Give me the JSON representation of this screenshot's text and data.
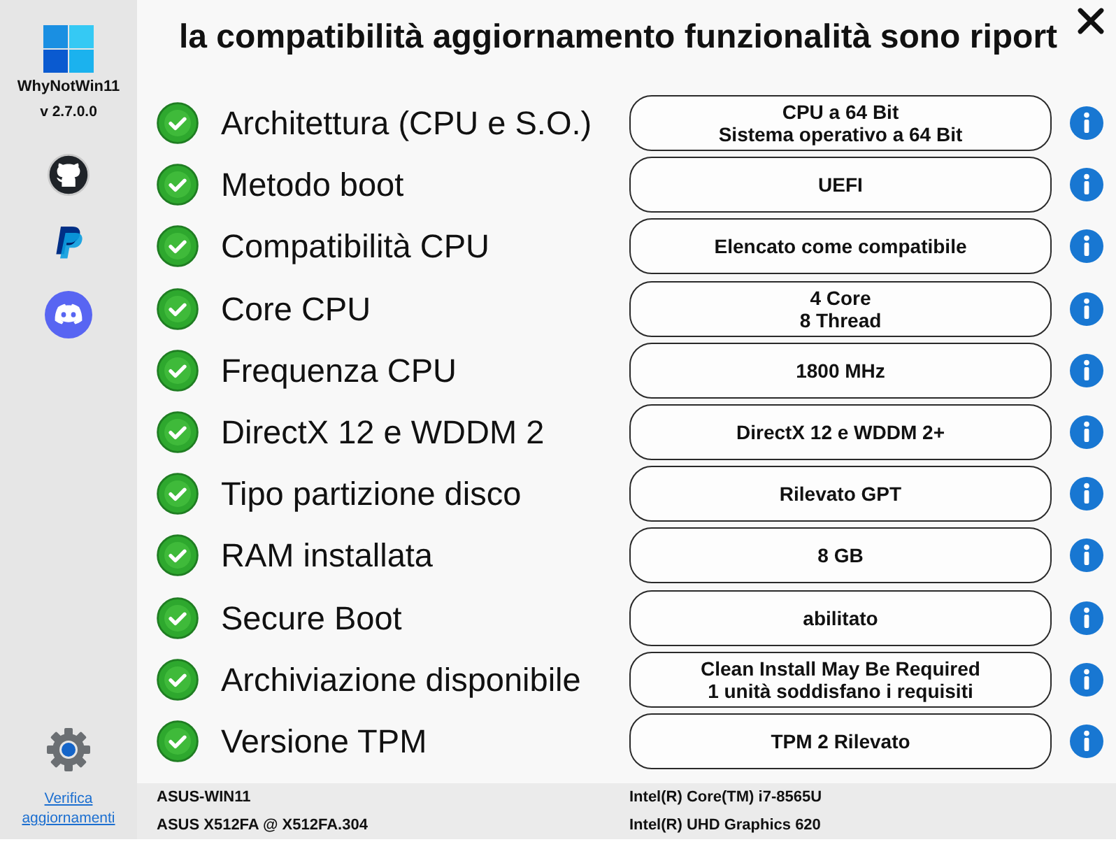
{
  "sidebar": {
    "app_name": "WhyNotWin11",
    "version": "v 2.7.0.0",
    "update_link": "Verifica aggiornamenti"
  },
  "title": "la compatibilità aggiornamento funzionalità sono riport",
  "checks": [
    {
      "passed": true,
      "label": "Architettura (CPU e S.O.)",
      "result": "CPU a 64 Bit\nSistema operativo a 64 Bit"
    },
    {
      "passed": true,
      "label": "Metodo boot",
      "result": "UEFI"
    },
    {
      "passed": true,
      "label": "Compatibilità CPU",
      "result": "Elencato come compatibile"
    },
    {
      "passed": true,
      "label": "Core CPU",
      "result": "4 Core\n8 Thread"
    },
    {
      "passed": true,
      "label": "Frequenza CPU",
      "result": "1800 MHz"
    },
    {
      "passed": true,
      "label": "DirectX 12 e WDDM 2",
      "result": "DirectX 12 e WDDM 2+"
    },
    {
      "passed": true,
      "label": "Tipo partizione disco",
      "result": "Rilevato GPT"
    },
    {
      "passed": true,
      "label": "RAM installata",
      "result": "8 GB"
    },
    {
      "passed": true,
      "label": "Secure Boot",
      "result": "abilitato"
    },
    {
      "passed": true,
      "label": "Archiviazione disponibile",
      "result": "Clean Install May Be Required\n1 unità soddisfano i requisiti"
    },
    {
      "passed": true,
      "label": "Versione TPM",
      "result": "TPM 2 Rilevato"
    }
  ],
  "footer": {
    "left": [
      "ASUS-WIN11",
      "ASUS X512FA @ X512FA.304"
    ],
    "right": [
      "Intel(R) Core(TM) i7-8565U",
      "Intel(R) UHD Graphics 620"
    ]
  }
}
